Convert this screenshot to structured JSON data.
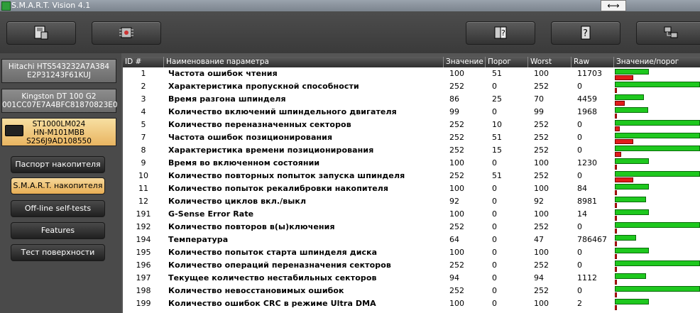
{
  "window": {
    "title": "S.M.A.R.T. Vision 4.1"
  },
  "drives": [
    {
      "line1": "Hitachi HTS543232A7A384",
      "line2": "E2P31243F61KUJ",
      "line3": ""
    },
    {
      "line1": "Kingston DT 100 G2",
      "line2": "001CC07E7A4BFC81870823E0",
      "line3": ""
    },
    {
      "line1": "ST1000LM024",
      "line2": "HN-M101MBB",
      "line3": "S2S6J9AD108550"
    }
  ],
  "nav": [
    {
      "label": "Паспорт накопителя"
    },
    {
      "label": "S.M.A.R.T. накопителя"
    },
    {
      "label": "Off-line self-tests"
    },
    {
      "label": "Features"
    },
    {
      "label": "Тест поверхности"
    }
  ],
  "table": {
    "headers": [
      "ID #",
      "Наименование параметра",
      "Значение",
      "Порог",
      "Worst",
      "Raw",
      "Значение/порог"
    ],
    "rows": [
      {
        "id": "1",
        "name": "Частота ошибок чтения",
        "value": "100",
        "threshold": "51",
        "worst": "100",
        "raw": "11703",
        "ratio_value": 0.4,
        "ratio_threshold": 0.2
      },
      {
        "id": "2",
        "name": "Характеристика пропускной способности",
        "value": "252",
        "threshold": "0",
        "worst": "252",
        "raw": "0",
        "ratio_value": 1.0,
        "ratio_threshold": 0.0
      },
      {
        "id": "3",
        "name": "Время разгона шпинделя",
        "value": "86",
        "threshold": "25",
        "worst": "70",
        "raw": "4459",
        "ratio_value": 0.34,
        "ratio_threshold": 0.1
      },
      {
        "id": "4",
        "name": "Количество включений шпиндельного двигателя",
        "value": "99",
        "threshold": "0",
        "worst": "99",
        "raw": "1968",
        "ratio_value": 0.39,
        "ratio_threshold": 0.0
      },
      {
        "id": "5",
        "name": "Количество переназначенных секторов",
        "value": "252",
        "threshold": "10",
        "worst": "252",
        "raw": "0",
        "ratio_value": 1.0,
        "ratio_threshold": 0.04
      },
      {
        "id": "7",
        "name": "Частота ошибок позиционирования",
        "value": "252",
        "threshold": "51",
        "worst": "252",
        "raw": "0",
        "ratio_value": 1.0,
        "ratio_threshold": 0.2
      },
      {
        "id": "8",
        "name": "Характеристика времени позиционирования",
        "value": "252",
        "threshold": "15",
        "worst": "252",
        "raw": "0",
        "ratio_value": 1.0,
        "ratio_threshold": 0.06
      },
      {
        "id": "9",
        "name": "Время во включенном состоянии",
        "value": "100",
        "threshold": "0",
        "worst": "100",
        "raw": "1230",
        "ratio_value": 0.4,
        "ratio_threshold": 0.0
      },
      {
        "id": "10",
        "name": "Количество повторных попыток запуска шпинделя",
        "value": "252",
        "threshold": "51",
        "worst": "252",
        "raw": "0",
        "ratio_value": 1.0,
        "ratio_threshold": 0.2
      },
      {
        "id": "11",
        "name": "Количество попыток рекалибровки накопителя",
        "value": "100",
        "threshold": "0",
        "worst": "100",
        "raw": "84",
        "ratio_value": 0.4,
        "ratio_threshold": 0.0
      },
      {
        "id": "12",
        "name": "Количество циклов вкл./выкл",
        "value": "92",
        "threshold": "0",
        "worst": "92",
        "raw": "8981",
        "ratio_value": 0.37,
        "ratio_threshold": 0.0
      },
      {
        "id": "191",
        "name": "G-Sense Error Rate",
        "value": "100",
        "threshold": "0",
        "worst": "100",
        "raw": "14",
        "ratio_value": 0.4,
        "ratio_threshold": 0.0
      },
      {
        "id": "192",
        "name": "Количество повторов в(ы)ключения",
        "value": "252",
        "threshold": "0",
        "worst": "252",
        "raw": "0",
        "ratio_value": 1.0,
        "ratio_threshold": 0.0
      },
      {
        "id": "194",
        "name": "Температура",
        "value": "64",
        "threshold": "0",
        "worst": "47",
        "raw": "786467",
        "ratio_value": 0.25,
        "ratio_threshold": 0.0
      },
      {
        "id": "195",
        "name": "Количество попыток старта шпинделя диска",
        "value": "100",
        "threshold": "0",
        "worst": "100",
        "raw": "0",
        "ratio_value": 0.4,
        "ratio_threshold": 0.0
      },
      {
        "id": "196",
        "name": "Количество операций переназначения секторов",
        "value": "252",
        "threshold": "0",
        "worst": "252",
        "raw": "0",
        "ratio_value": 1.0,
        "ratio_threshold": 0.0
      },
      {
        "id": "197",
        "name": "Текущее количество нестабильных секторов",
        "value": "94",
        "threshold": "0",
        "worst": "94",
        "raw": "1112",
        "ratio_value": 0.37,
        "ratio_threshold": 0.0
      },
      {
        "id": "198",
        "name": "Количество невосстановимых ошибок",
        "value": "252",
        "threshold": "0",
        "worst": "252",
        "raw": "0",
        "ratio_value": 1.0,
        "ratio_threshold": 0.0
      },
      {
        "id": "199",
        "name": "Количество ошибок CRC в режиме Ultra DMA",
        "value": "100",
        "threshold": "0",
        "worst": "100",
        "raw": "2",
        "ratio_value": 0.4,
        "ratio_threshold": 0.0
      }
    ]
  },
  "colors": {
    "bar_value": "#1ec81e",
    "bar_threshold": "#e21b1b",
    "active_accent": "#e9b561"
  }
}
